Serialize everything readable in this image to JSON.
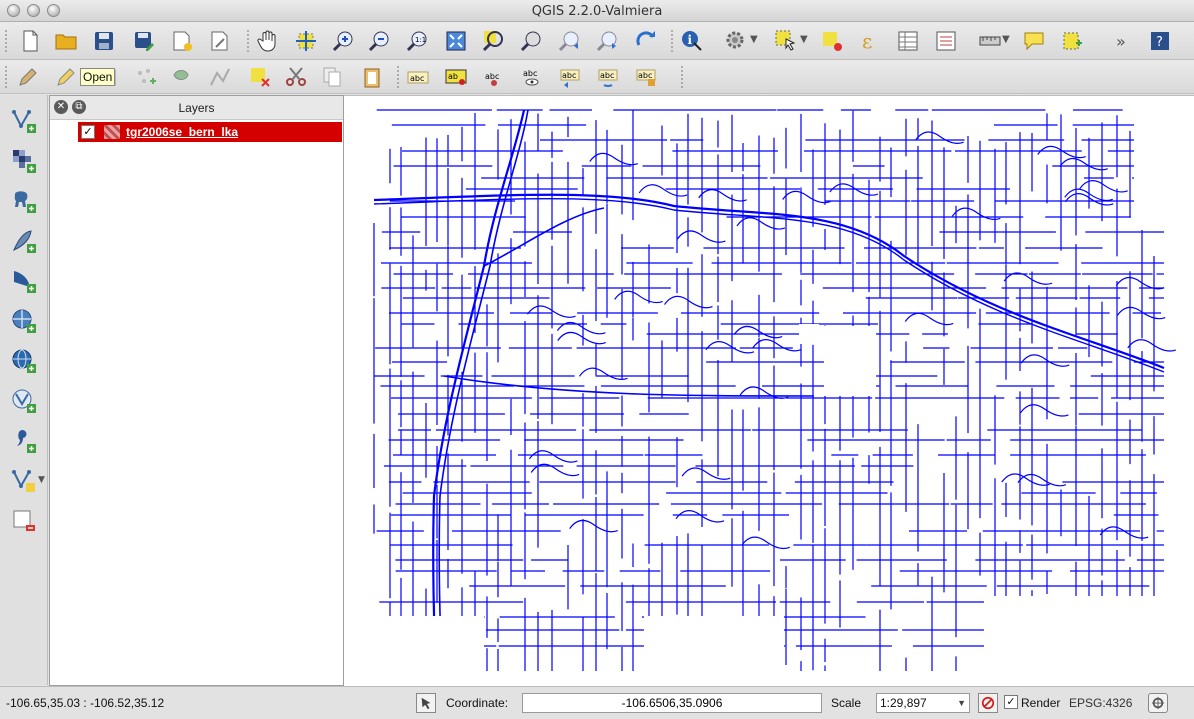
{
  "window": {
    "title": "QGIS 2.2.0-Valmiera"
  },
  "toolbar_main": {
    "tools": [
      "new-project",
      "open-project",
      "save-project",
      "save-as",
      "new-print-composer",
      "composer-manager",
      "pan",
      "pan-to-selection",
      "zoom-in",
      "zoom-out",
      "zoom-actual",
      "zoom-full",
      "zoom-to-selection",
      "zoom-to-layer",
      "zoom-last",
      "zoom-next",
      "refresh",
      "identify",
      "run-action",
      "select-features",
      "deselect",
      "field-calculator",
      "attribute-table",
      "statistics",
      "measure",
      "map-tips",
      "new-bookmark",
      "overflow",
      "help"
    ],
    "overflow_label": "»"
  },
  "toolbar_digitize": {
    "tools": [
      "current-edits",
      "toggle-editing",
      "save-edits",
      "add-feature",
      "move-feature",
      "node-tool",
      "delete-selected",
      "cut-features",
      "copy-features",
      "paste-features",
      "label",
      "label-pin",
      "label-highlight",
      "show-hide-labels",
      "move-label",
      "rotate-label",
      "change-label"
    ]
  },
  "tooltip": {
    "text": "Open"
  },
  "left_toolbar": {
    "tools": [
      "add-vector-layer",
      "add-raster-layer",
      "add-postgis-layer",
      "add-spatialite-layer",
      "add-mssql-layer",
      "add-wms-layer",
      "add-wcs-layer",
      "add-wfs-layer",
      "add-delimited-text-layer",
      "new-shapefile-layer",
      "remove-layer"
    ]
  },
  "layers_panel": {
    "title": "Layers",
    "close_label": "✕",
    "float_label": "⧉",
    "layers": [
      {
        "name": "tgr2006se_bern_lka",
        "checked": true,
        "check_mark": "✓"
      }
    ]
  },
  "map": {
    "line_color": "#0000ff",
    "background": "#ffffff"
  },
  "statusbar": {
    "extent_text": "-106.65,35.03 : -106.52,35.12",
    "coordinate_label": "Coordinate:",
    "coordinate_value": "-106.6506,35.0906",
    "scale_label": "Scale",
    "scale_value": "1:29,897",
    "render_label": "Render",
    "render_checked": true,
    "render_check_mark": "✓",
    "crs_label": "EPSG:4326"
  }
}
